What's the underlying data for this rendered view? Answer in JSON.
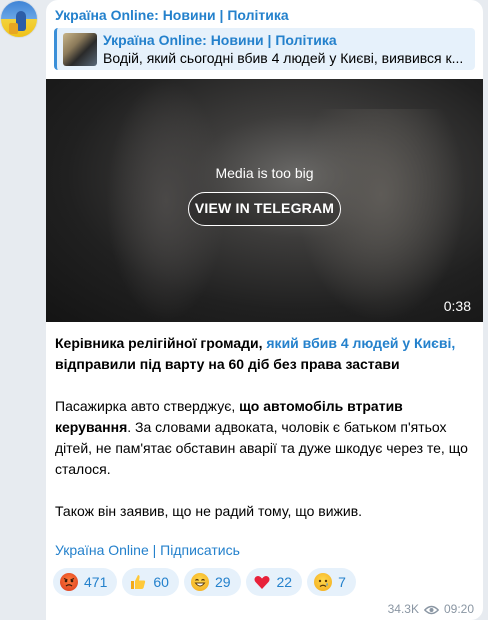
{
  "post": {
    "channel_title": "Україна Online: Новини | Політика",
    "reply": {
      "title": "Україна Online: Новини | Політика",
      "text": "Водій, який сьогодні вбив 4 людей у Києві, виявився к..."
    },
    "media": {
      "message": "Media is too big",
      "button_label": "VIEW IN TELEGRAM",
      "duration": "0:38"
    },
    "body": {
      "p1_bold1": "Керівника релігійної громади, ",
      "p1_link": "який вбив 4 людей у Києві,",
      "p1_bold2": " відправили під варту на 60 діб без права застави",
      "p2_text1": "Пасажирка авто стверджує, ",
      "p2_bold": "що автомобіль втратив керування",
      "p2_text2": ". За словами адвоката, чоловік є батьком п'ятьох дітей, не пам'ятає обставин аварії та дуже шкодує через те, що сталося.",
      "p3_text": "Також він заявив, що не радий тому, що вижив."
    },
    "subscribe_link": "Україна Online | Підписатись",
    "reactions": [
      {
        "icon": "angry-face-icon",
        "count": "471"
      },
      {
        "icon": "thumbs-up-icon",
        "count": "60"
      },
      {
        "icon": "grinning-face-icon",
        "count": "29"
      },
      {
        "icon": "red-heart-icon",
        "count": "22"
      },
      {
        "icon": "sad-face-icon",
        "count": "7"
      }
    ],
    "views": "34.3K",
    "time": "09:20"
  },
  "colors": {
    "background": "#e7ebf0",
    "link": "#2481cc",
    "reaction_bg": "#e6f1fb",
    "meta": "#8a96a3"
  }
}
